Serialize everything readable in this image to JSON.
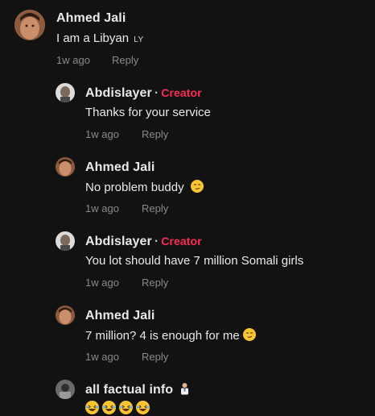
{
  "comments": [
    {
      "author": "Ahmed Jali",
      "text": "I am a Libyan",
      "flag_code": "LY",
      "time": "1w ago",
      "reply_label": "Reply"
    },
    {
      "author": "Abdislayer",
      "creator_label": "Creator",
      "text": "Thanks for your service",
      "time": "1w ago",
      "reply_label": "Reply"
    },
    {
      "author": "Ahmed Jali",
      "text": "No problem buddy",
      "time": "1w ago",
      "reply_label": "Reply"
    },
    {
      "author": "Abdislayer",
      "creator_label": "Creator",
      "text": "You lot should have 7 million Somali girls",
      "time": "1w ago",
      "reply_label": "Reply"
    },
    {
      "author": "Ahmed Jali",
      "text": "7 million? 4 is enough for me",
      "time": "1w ago",
      "reply_label": "Reply"
    },
    {
      "author": "all factual info",
      "emoji_count": 4
    }
  ],
  "colors": {
    "background": "#121212",
    "creator": "#fe2c55",
    "meta": "#8a8a8a",
    "text": "#e9e9e9"
  }
}
